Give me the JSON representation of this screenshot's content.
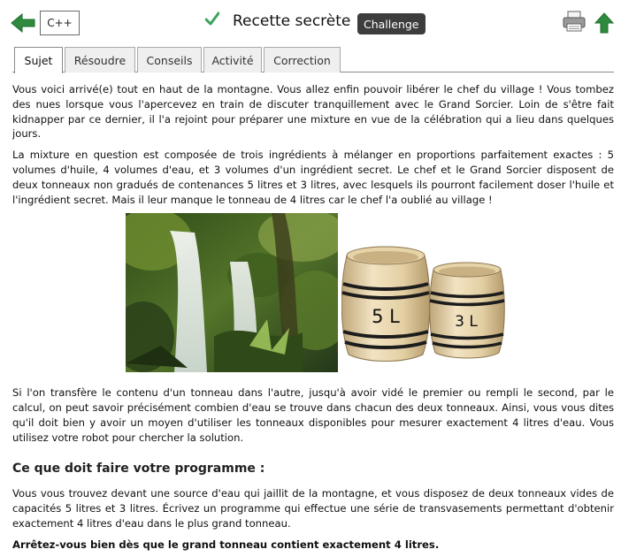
{
  "header": {
    "language": "C++",
    "title": "Recette secrète",
    "badge": "Challenge"
  },
  "tabs": [
    {
      "label": "Sujet",
      "active": true
    },
    {
      "label": "Résoudre",
      "active": false
    },
    {
      "label": "Conseils",
      "active": false
    },
    {
      "label": "Activité",
      "active": false
    },
    {
      "label": "Correction",
      "active": false
    }
  ],
  "content": {
    "p1": "Vous voici arrivé(e) tout en haut de la montagne. Vous allez enfin pouvoir libérer le chef du village ! Vous tombez des nues lorsque vous l'apercevez en train de discuter tranquillement avec le Grand Sorcier. Loin de s'être fait kidnapper par ce dernier, il l'a rejoint pour préparer une mixture en vue de la célébration qui a lieu dans quelques jours.",
    "p2": "La mixture en question est composée de trois ingrédients à mélanger en proportions parfaitement exactes : 5 volumes d'huile, 4 volumes d'eau, et 3 volumes d'un ingrédient secret. Le chef et le Grand Sorcier disposent de deux tonneaux non gradués de contenances 5 litres et 3 litres, avec lesquels ils pourront facilement doser l'huile et l'ingrédient secret. Mais il leur manque le tonneau de 4 litres car le chef l'a oublié au village !",
    "barrel_big_label": "5 L",
    "barrel_small_label": "3 L",
    "p3": "Si l'on transfère le contenu d'un tonneau dans l'autre, jusqu'à avoir vidé le premier ou rempli le second, par le calcul, on peut savoir précisément combien d'eau se trouve dans chacun des deux tonneaux. Ainsi, vous vous dites qu'il doit bien y avoir un moyen d'utiliser les tonneaux disponibles pour mesurer exactement 4 litres d'eau. Vous utilisez votre robot pour chercher la solution.",
    "section_title": "Ce que doit faire votre programme :",
    "p4": "Vous vous trouvez devant une source d'eau qui jaillit de la montagne, et vous disposez de deux tonneaux vides de capacités 5 litres et 3 litres. Écrivez un programme qui effectue une série de transvasements permettant d'obtenir exactement 4 litres d'eau dans le plus grand tonneau.",
    "p5": "Arrêtez-vous bien dès que le grand tonneau contient exactement 4 litres."
  },
  "colors": {
    "arrow_green": "#2e8b3d",
    "check_green": "#3aa35a",
    "badge_bg": "#3d3d3d"
  },
  "icons": {
    "back": "arrow-left-icon",
    "check": "checkmark-icon",
    "print": "printer-icon",
    "up": "arrow-up-icon"
  }
}
